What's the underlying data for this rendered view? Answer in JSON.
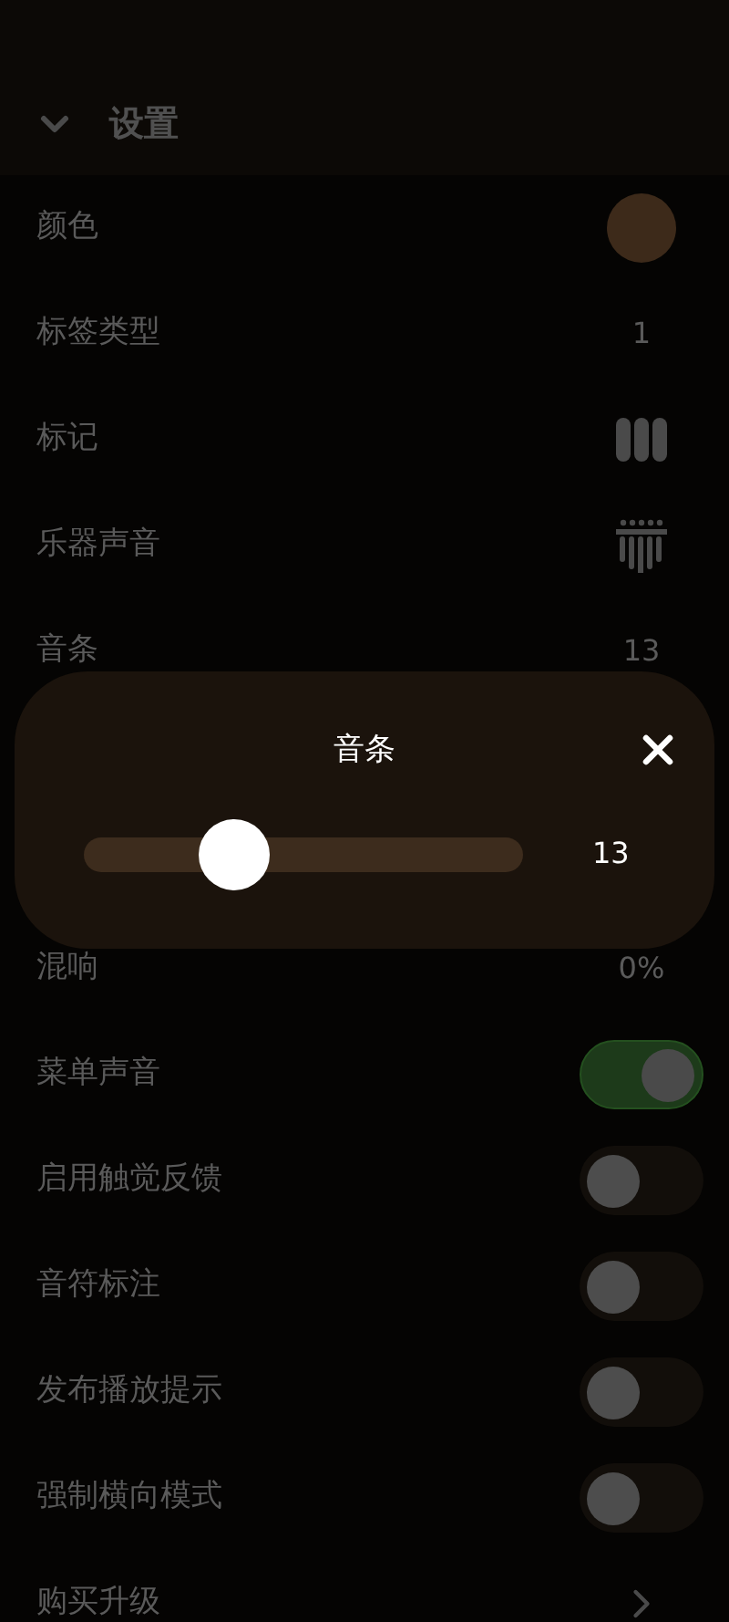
{
  "header": {
    "title": "设置",
    "expanded": true
  },
  "rows": [
    {
      "kind": "color",
      "label": "颜色",
      "color": "#3d2a1a"
    },
    {
      "kind": "value",
      "label": "标签类型",
      "value": "1"
    },
    {
      "kind": "bars",
      "label": "标记"
    },
    {
      "kind": "kalimba",
      "label": "乐器声音"
    },
    {
      "kind": "value",
      "label": "音条",
      "value": "13"
    },
    {
      "kind": "hidden"
    },
    {
      "kind": "hidden"
    },
    {
      "kind": "value",
      "label": "混响",
      "value": "0%"
    },
    {
      "kind": "toggle",
      "label": "菜单声音",
      "on": true
    },
    {
      "kind": "toggle",
      "label": "启用触觉反馈",
      "on": false
    },
    {
      "kind": "toggle",
      "label": "音符标注",
      "on": false
    },
    {
      "kind": "toggle",
      "label": "发布播放提示",
      "on": false
    },
    {
      "kind": "toggle",
      "label": "强制横向模式",
      "on": false
    },
    {
      "kind": "link",
      "label": "购买升级"
    }
  ],
  "dialog": {
    "title": "音条",
    "level": 0.34,
    "reading": "13"
  }
}
